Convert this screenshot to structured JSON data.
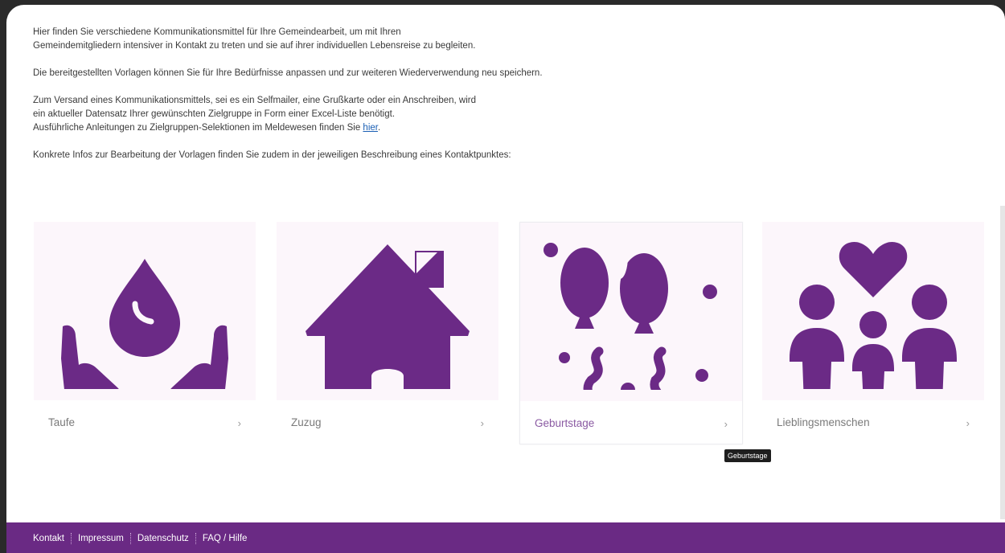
{
  "intro": {
    "p1_line1": "Hier finden Sie verschiedene Kommunikationsmittel für Ihre Gemeindearbeit, um mit Ihren",
    "p1_line2": "Gemeindemitgliedern intensiver in Kontakt zu treten und sie auf ihrer individuellen Lebensreise zu begleiten.",
    "p2": "Die bereitgestellten Vorlagen können Sie für Ihre Bedürfnisse anpassen und zur weiteren Wiederverwendung neu speichern.",
    "p3_line1": "Zum Versand eines Kommunikationsmittels, sei es ein Selfmailer, eine Grußkarte oder ein Anschreiben, wird",
    "p3_line2": "ein aktueller Datensatz Ihrer gewünschten Zielgruppe in Form einer Excel-Liste benötigt.",
    "p3_line3_prefix": "Ausführliche Anleitungen zu Zielgruppen-Selektionen im Meldewesen finden Sie ",
    "p3_link": "hier",
    "p3_suffix": ".",
    "p4": "Konkrete Infos zur Bearbeitung der Vorlagen finden Sie zudem in der jeweiligen Beschreibung eines Kontaktpunktes:"
  },
  "cards": [
    {
      "label": "Taufe",
      "icon": "hands-water-drop-icon",
      "chevron": "›"
    },
    {
      "label": "Zuzug",
      "icon": "house-icon",
      "chevron": "›"
    },
    {
      "label": "Geburtstage",
      "icon": "balloons-icon",
      "chevron": "›"
    },
    {
      "label": "Lieblingsmenschen",
      "icon": "family-heart-icon",
      "chevron": "›"
    }
  ],
  "tooltip": "Geburtstage",
  "footer": {
    "links": [
      "Kontakt",
      "Impressum",
      "Datenschutz",
      "FAQ / Hilfe"
    ]
  },
  "colors": {
    "accent": "#6a2a84",
    "icon": "#6b2a86",
    "card_bg": "#fcf6fb",
    "link": "#1a5fb4"
  }
}
